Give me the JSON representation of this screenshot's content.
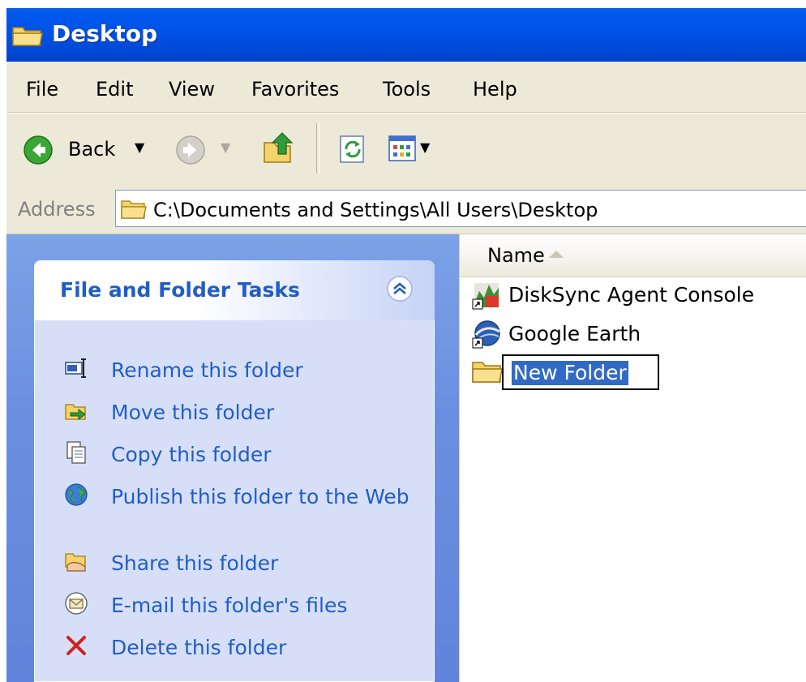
{
  "window": {
    "title": "Desktop"
  },
  "menu": [
    "File",
    "Edit",
    "View",
    "Favorites",
    "Tools",
    "Help"
  ],
  "toolbar": {
    "back_label": "Back"
  },
  "address": {
    "label": "Address",
    "path": "C:\\Documents and Settings\\All Users\\Desktop"
  },
  "task_pane": {
    "title": "File and Folder Tasks",
    "tasks": [
      {
        "label": "Rename this folder",
        "icon": "rename-icon"
      },
      {
        "label": "Move this folder",
        "icon": "move-icon"
      },
      {
        "label": "Copy this folder",
        "icon": "copy-icon"
      },
      {
        "label": "Publish this folder to the Web",
        "icon": "globe-icon"
      },
      {
        "label": "Share this folder",
        "icon": "share-icon"
      },
      {
        "label": "E-mail this folder's files",
        "icon": "email-icon"
      },
      {
        "label": "Delete this folder",
        "icon": "delete-icon"
      }
    ]
  },
  "file_list": {
    "column_name": "Name",
    "sort": "ascending",
    "items": [
      {
        "name": "DiskSync Agent Console",
        "type": "shortcut"
      },
      {
        "name": "Google Earth",
        "type": "shortcut"
      },
      {
        "name": "New Folder",
        "type": "folder",
        "editing": true
      }
    ]
  },
  "colors": {
    "titlebar": "#0052e6",
    "task_link": "#215dc6",
    "task_pane_bg": "#6b8fe0",
    "selection": "#316ac5"
  }
}
